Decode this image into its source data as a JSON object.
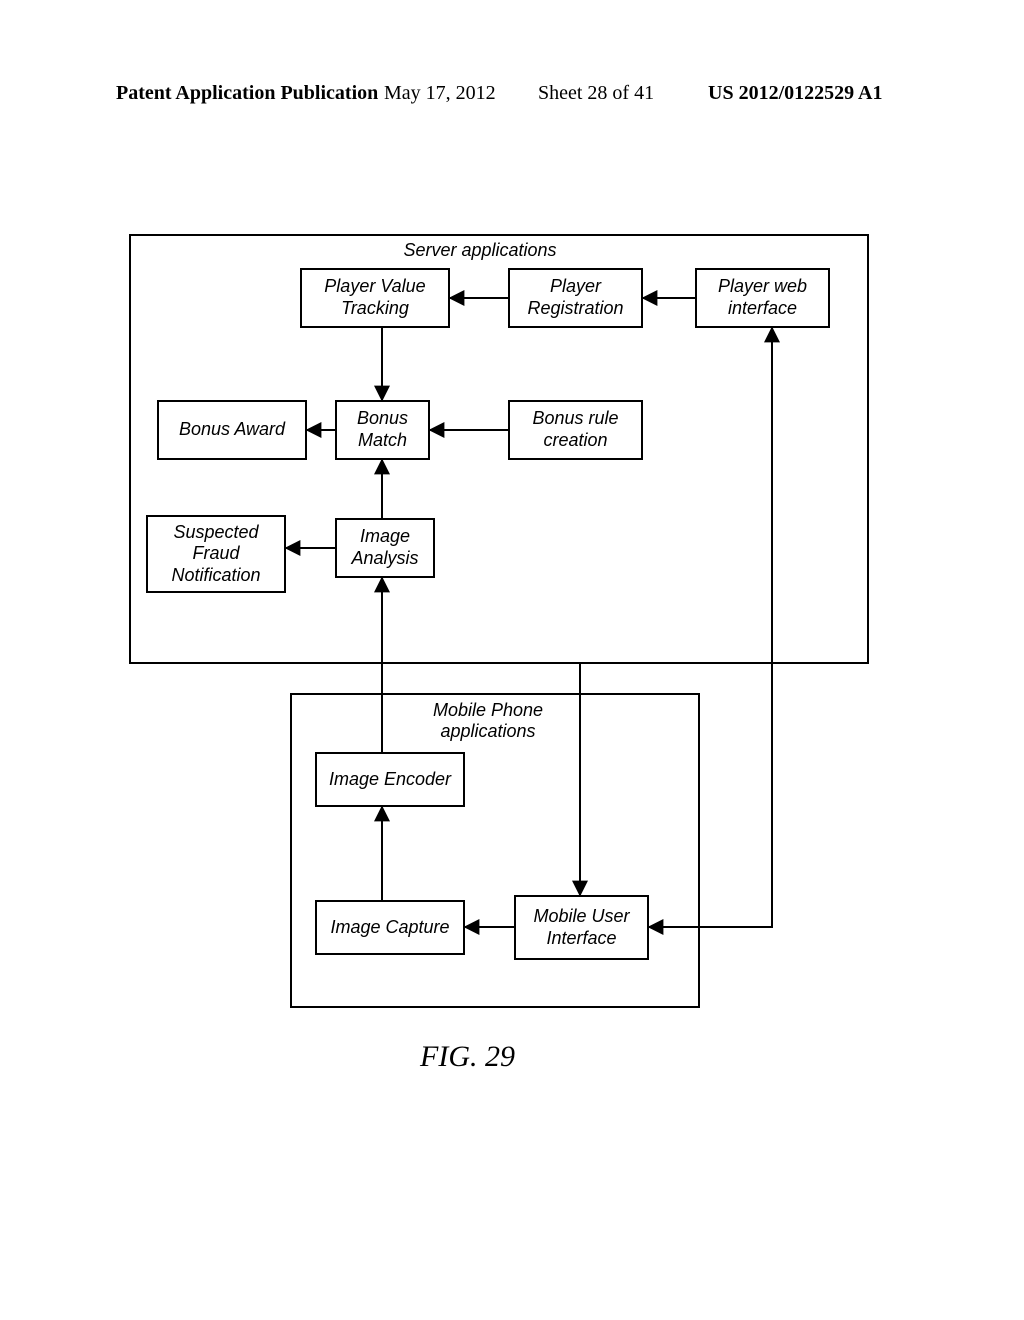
{
  "header": {
    "publication_label": "Patent Application Publication",
    "date": "May 17, 2012",
    "sheet": "Sheet 28 of 41",
    "doc_number": "US 2012/0122529 A1"
  },
  "diagram": {
    "server_group_label": "Server applications",
    "mobile_group_label": "Mobile Phone applications",
    "boxes": {
      "player_value_tracking": "Player Value Tracking",
      "player_registration": "Player Registration",
      "player_web_interface": "Player web interface",
      "bonus_award": "Bonus Award",
      "bonus_match": "Bonus Match",
      "bonus_rule_creation": "Bonus rule creation",
      "suspected_fraud": "Suspected Fraud Notification",
      "image_analysis": "Image Analysis",
      "image_encoder": "Image Encoder",
      "image_capture": "Image Capture",
      "mobile_ui": "Mobile User Interface"
    },
    "figure_label": "FIG. 29"
  },
  "chart_data": {
    "type": "diagram",
    "groups": [
      {
        "name": "Server applications",
        "nodes": [
          "Player Value Tracking",
          "Player Registration",
          "Player web interface",
          "Bonus Award",
          "Bonus Match",
          "Bonus rule creation",
          "Suspected Fraud Notification",
          "Image Analysis"
        ]
      },
      {
        "name": "Mobile Phone applications",
        "nodes": [
          "Image Encoder",
          "Image Capture",
          "Mobile User Interface"
        ]
      }
    ],
    "edges": [
      {
        "from": "Player web interface",
        "to": "Player Registration"
      },
      {
        "from": "Player Registration",
        "to": "Player Value Tracking"
      },
      {
        "from": "Player Value Tracking",
        "to": "Bonus Match"
      },
      {
        "from": "Bonus rule creation",
        "to": "Bonus Match"
      },
      {
        "from": "Bonus Match",
        "to": "Bonus Award"
      },
      {
        "from": "Image Analysis",
        "to": "Bonus Match"
      },
      {
        "from": "Image Analysis",
        "to": "Suspected Fraud Notification"
      },
      {
        "from": "Image Encoder",
        "to": "Image Analysis"
      },
      {
        "from": "Image Capture",
        "to": "Image Encoder"
      },
      {
        "from": "Mobile User Interface",
        "to": "Image Capture"
      },
      {
        "from": "Player web interface",
        "to": "Mobile User Interface"
      },
      {
        "from": "Mobile User Interface",
        "to": "Player web interface"
      }
    ]
  }
}
